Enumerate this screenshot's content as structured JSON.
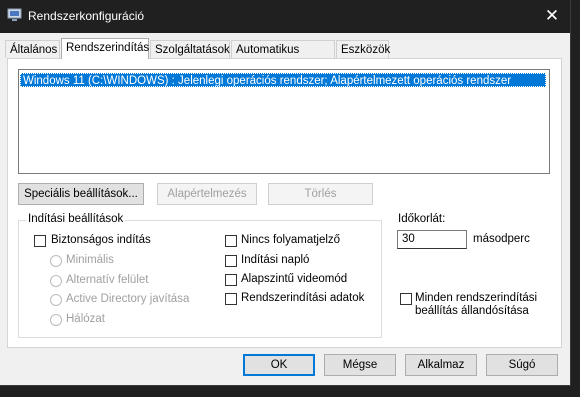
{
  "window": {
    "title": "Rendszerkonfiguráció",
    "close_glyph": "✕"
  },
  "tabs": [
    {
      "label": "Általános"
    },
    {
      "label": "Rendszerindítás"
    },
    {
      "label": "Szolgáltatások"
    },
    {
      "label": "Automatikus indítás"
    },
    {
      "label": "Eszközök"
    }
  ],
  "os_list": {
    "selected": "Windows 11 (C:\\WINDOWS) : Jelenlegi operációs rendszer; Alapértelmezett operációs rendszer"
  },
  "list_buttons": {
    "advanced": "Speciális beállítások...",
    "set_default": "Alapértelmezés",
    "delete": "Törlés"
  },
  "boot_options": {
    "group_label": "Indítási beállítások",
    "safe_boot": "Biztonságos indítás",
    "minimal": "Minimális",
    "alternate_shell": "Alternatív felület",
    "ad_repair": "Active Directory javítása",
    "network": "Hálózat",
    "no_gui_boot": "Nincs folyamatjelző",
    "boot_log": "Indítási napló",
    "base_video": "Alapszintű videomód",
    "os_boot_info": "Rendszerindítási adatok"
  },
  "timeout": {
    "label": "Időkorlát:",
    "value": "30",
    "unit": "másodperc"
  },
  "make_permanent": {
    "line1": "Minden rendszerindítási",
    "line2": "beállítás állandósítása"
  },
  "footer": {
    "ok": "OK",
    "cancel": "Mégse",
    "apply": "Alkalmaz",
    "help": "Súgó"
  }
}
